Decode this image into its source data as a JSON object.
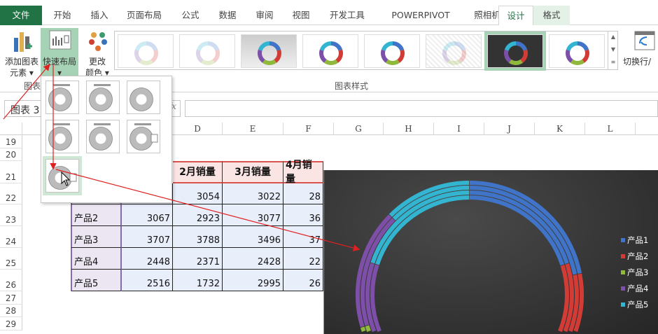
{
  "ribbon_tabs": [
    "文件",
    "开始",
    "插入",
    "页面布局",
    "公式",
    "数据",
    "审阅",
    "视图",
    "开发工具",
    "POWERPIVOT",
    "照相机",
    "设计",
    "格式"
  ],
  "ribbon": {
    "add_chart_element": [
      "添加图表",
      "元素 ▾"
    ],
    "quick_layout": [
      "快速布局",
      "▾"
    ],
    "change_colors": [
      "更改",
      "颜色 ▾"
    ],
    "switch_row_col": "切换行/",
    "group_chart_layout": "图表",
    "group_chart_styles": "图表样式"
  },
  "name_box": "图表 3",
  "formula_fx": "fx",
  "columns": [
    "D",
    "E",
    "F",
    "G",
    "H",
    "I",
    "J",
    "K",
    "L"
  ],
  "rows": [
    "19",
    "20",
    "21",
    "22",
    "23",
    "24",
    "25",
    "26",
    "27",
    "28",
    "29"
  ],
  "table": {
    "headers": [
      "2月销量",
      "3月销量",
      "4月销量"
    ],
    "rows": [
      {
        "name": "",
        "c": "",
        "d": "3054",
        "e": "3022",
        "f": "28"
      },
      {
        "name": "产品2",
        "c": "3067",
        "d": "2923",
        "e": "3077",
        "f": "36"
      },
      {
        "name": "产品3",
        "c": "3707",
        "d": "3788",
        "e": "3496",
        "f": "37"
      },
      {
        "name": "产品4",
        "c": "2448",
        "d": "2371",
        "e": "2428",
        "f": "22"
      },
      {
        "name": "产品5",
        "c": "2516",
        "d": "1732",
        "e": "2995",
        "f": "26"
      }
    ]
  },
  "chart_data": {
    "type": "pie",
    "subtype": "doughnut",
    "categories": [
      "产品1",
      "产品2",
      "产品3",
      "产品4",
      "产品5"
    ],
    "series": [
      {
        "name": "2月销量",
        "values": [
          3054,
          2923,
          3788,
          2371,
          1732
        ]
      },
      {
        "name": "3月销量",
        "values": [
          3022,
          3077,
          3496,
          2428,
          2995
        ]
      }
    ],
    "colors": [
      "#3f74c8",
      "#d23c36",
      "#90b83c",
      "#7d4fa8",
      "#33b5d2"
    ],
    "legend": "right"
  }
}
